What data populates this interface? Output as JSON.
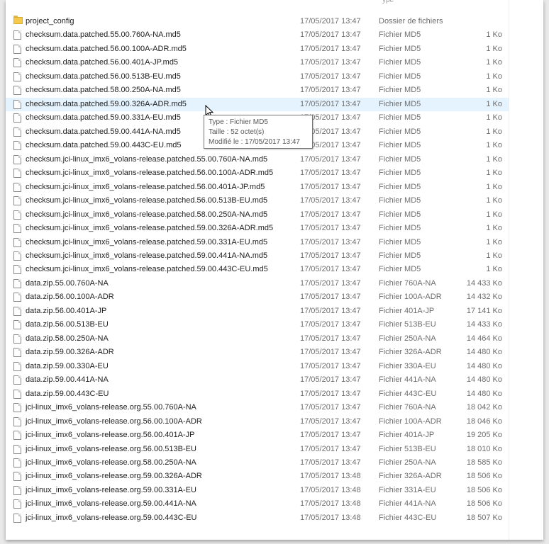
{
  "header": {
    "type_partial": "ype"
  },
  "rows": [
    {
      "name": "project_config",
      "date": "17/05/2017 13:47",
      "type": "Dossier de fichiers",
      "size": "",
      "icon": "folder-icon"
    },
    {
      "name": "checksum.data.patched.55.00.760A-NA.md5",
      "date": "17/05/2017 13:47",
      "type": "Fichier MD5",
      "size": "1 Ko",
      "icon": "file-icon"
    },
    {
      "name": "checksum.data.patched.56.00.100A-ADR.md5",
      "date": "17/05/2017 13:47",
      "type": "Fichier MD5",
      "size": "1 Ko",
      "icon": "file-icon"
    },
    {
      "name": "checksum.data.patched.56.00.401A-JP.md5",
      "date": "17/05/2017 13:47",
      "type": "Fichier MD5",
      "size": "1 Ko",
      "icon": "file-icon"
    },
    {
      "name": "checksum.data.patched.56.00.513B-EU.md5",
      "date": "17/05/2017 13:47",
      "type": "Fichier MD5",
      "size": "1 Ko",
      "icon": "file-icon"
    },
    {
      "name": "checksum.data.patched.58.00.250A-NA.md5",
      "date": "17/05/2017 13:47",
      "type": "Fichier MD5",
      "size": "1 Ko",
      "icon": "file-icon"
    },
    {
      "name": "checksum.data.patched.59.00.326A-ADR.md5",
      "date": "17/05/2017 13:47",
      "type": "Fichier MD5",
      "size": "1 Ko",
      "icon": "file-icon",
      "selected": true
    },
    {
      "name": "checksum.data.patched.59.00.331A-EU.md5",
      "date": "17/05/2017 13:47",
      "type": "Fichier MD5",
      "size": "1 Ko",
      "icon": "file-icon"
    },
    {
      "name": "checksum.data.patched.59.00.441A-NA.md5",
      "date": "17/05/2017 13:47",
      "type": "Fichier MD5",
      "size": "1 Ko",
      "icon": "file-icon"
    },
    {
      "name": "checksum.data.patched.59.00.443C-EU.md5",
      "date": "17/05/2017 13:47",
      "type": "Fichier MD5",
      "size": "1 Ko",
      "icon": "file-icon"
    },
    {
      "name": "checksum.jci-linux_imx6_volans-release.patched.55.00.760A-NA.md5",
      "date": "17/05/2017 13:47",
      "type": "Fichier MD5",
      "size": "1 Ko",
      "icon": "file-icon"
    },
    {
      "name": "checksum.jci-linux_imx6_volans-release.patched.56.00.100A-ADR.md5",
      "date": "17/05/2017 13:47",
      "type": "Fichier MD5",
      "size": "1 Ko",
      "icon": "file-icon"
    },
    {
      "name": "checksum.jci-linux_imx6_volans-release.patched.56.00.401A-JP.md5",
      "date": "17/05/2017 13:47",
      "type": "Fichier MD5",
      "size": "1 Ko",
      "icon": "file-icon"
    },
    {
      "name": "checksum.jci-linux_imx6_volans-release.patched.56.00.513B-EU.md5",
      "date": "17/05/2017 13:47",
      "type": "Fichier MD5",
      "size": "1 Ko",
      "icon": "file-icon"
    },
    {
      "name": "checksum.jci-linux_imx6_volans-release.patched.58.00.250A-NA.md5",
      "date": "17/05/2017 13:47",
      "type": "Fichier MD5",
      "size": "1 Ko",
      "icon": "file-icon"
    },
    {
      "name": "checksum.jci-linux_imx6_volans-release.patched.59.00.326A-ADR.md5",
      "date": "17/05/2017 13:47",
      "type": "Fichier MD5",
      "size": "1 Ko",
      "icon": "file-icon"
    },
    {
      "name": "checksum.jci-linux_imx6_volans-release.patched.59.00.331A-EU.md5",
      "date": "17/05/2017 13:47",
      "type": "Fichier MD5",
      "size": "1 Ko",
      "icon": "file-icon"
    },
    {
      "name": "checksum.jci-linux_imx6_volans-release.patched.59.00.441A-NA.md5",
      "date": "17/05/2017 13:47",
      "type": "Fichier MD5",
      "size": "1 Ko",
      "icon": "file-icon"
    },
    {
      "name": "checksum.jci-linux_imx6_volans-release.patched.59.00.443C-EU.md5",
      "date": "17/05/2017 13:47",
      "type": "Fichier MD5",
      "size": "1 Ko",
      "icon": "file-icon"
    },
    {
      "name": "data.zip.55.00.760A-NA",
      "date": "17/05/2017 13:47",
      "type": "Fichier 760A-NA",
      "size": "14 433 Ko",
      "icon": "file-icon"
    },
    {
      "name": "data.zip.56.00.100A-ADR",
      "date": "17/05/2017 13:47",
      "type": "Fichier 100A-ADR",
      "size": "14 432 Ko",
      "icon": "file-icon"
    },
    {
      "name": "data.zip.56.00.401A-JP",
      "date": "17/05/2017 13:47",
      "type": "Fichier 401A-JP",
      "size": "17 141 Ko",
      "icon": "file-icon"
    },
    {
      "name": "data.zip.56.00.513B-EU",
      "date": "17/05/2017 13:47",
      "type": "Fichier 513B-EU",
      "size": "14 433 Ko",
      "icon": "file-icon"
    },
    {
      "name": "data.zip.58.00.250A-NA",
      "date": "17/05/2017 13:47",
      "type": "Fichier 250A-NA",
      "size": "14 464 Ko",
      "icon": "file-icon"
    },
    {
      "name": "data.zip.59.00.326A-ADR",
      "date": "17/05/2017 13:47",
      "type": "Fichier 326A-ADR",
      "size": "14 480 Ko",
      "icon": "file-icon"
    },
    {
      "name": "data.zip.59.00.330A-EU",
      "date": "17/05/2017 13:47",
      "type": "Fichier 330A-EU",
      "size": "14 480 Ko",
      "icon": "file-icon"
    },
    {
      "name": "data.zip.59.00.441A-NA",
      "date": "17/05/2017 13:47",
      "type": "Fichier 441A-NA",
      "size": "14 480 Ko",
      "icon": "file-icon"
    },
    {
      "name": "data.zip.59.00.443C-EU",
      "date": "17/05/2017 13:47",
      "type": "Fichier 443C-EU",
      "size": "14 480 Ko",
      "icon": "file-icon"
    },
    {
      "name": "jci-linux_imx6_volans-release.org.55.00.760A-NA",
      "date": "17/05/2017 13:47",
      "type": "Fichier 760A-NA",
      "size": "18 042 Ko",
      "icon": "file-icon"
    },
    {
      "name": "jci-linux_imx6_volans-release.org.56.00.100A-ADR",
      "date": "17/05/2017 13:47",
      "type": "Fichier 100A-ADR",
      "size": "18 046 Ko",
      "icon": "file-icon"
    },
    {
      "name": "jci-linux_imx6_volans-release.org.56.00.401A-JP",
      "date": "17/05/2017 13:47",
      "type": "Fichier 401A-JP",
      "size": "19 205 Ko",
      "icon": "file-icon"
    },
    {
      "name": "jci-linux_imx6_volans-release.org.56.00.513B-EU",
      "date": "17/05/2017 13:47",
      "type": "Fichier 513B-EU",
      "size": "18 010 Ko",
      "icon": "file-icon"
    },
    {
      "name": "jci-linux_imx6_volans-release.org.58.00.250A-NA",
      "date": "17/05/2017 13:47",
      "type": "Fichier 250A-NA",
      "size": "18 585 Ko",
      "icon": "file-icon"
    },
    {
      "name": "jci-linux_imx6_volans-release.org.59.00.326A-ADR",
      "date": "17/05/2017 13:48",
      "type": "Fichier 326A-ADR",
      "size": "18 506 Ko",
      "icon": "file-icon"
    },
    {
      "name": "jci-linux_imx6_volans-release.org.59.00.331A-EU",
      "date": "17/05/2017 13:48",
      "type": "Fichier 331A-EU",
      "size": "18 506 Ko",
      "icon": "file-icon"
    },
    {
      "name": "jci-linux_imx6_volans-release.org.59.00.441A-NA",
      "date": "17/05/2017 13:48",
      "type": "Fichier 441A-NA",
      "size": "18 506 Ko",
      "icon": "file-icon"
    },
    {
      "name": "jci-linux_imx6_volans-release.org.59.00.443C-EU",
      "date": "17/05/2017 13:48",
      "type": "Fichier 443C-EU",
      "size": "18 507 Ko",
      "icon": "file-icon"
    }
  ],
  "tooltip": {
    "type_line": "Type : Fichier MD5",
    "size_line": "Taille : 52 octet(s)",
    "modified_line": "Modifié le : 17/05/2017 13:47"
  },
  "colors": {
    "selected_row": "#e5f3ff",
    "folder": "#f5c94c"
  }
}
